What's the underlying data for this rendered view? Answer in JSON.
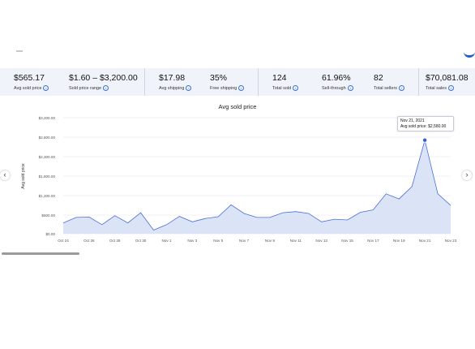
{
  "stats": [
    {
      "value": "$565.17",
      "label": "Avg sold price"
    },
    {
      "value": "$1.60 – $3,200.00",
      "label": "Sold price range"
    },
    {
      "value": "$17.98",
      "label": "Avg shipping"
    },
    {
      "value": "35%",
      "label": "Free shipping"
    },
    {
      "value": "124",
      "label": "Total sold"
    },
    {
      "value": "61.96%",
      "label": "Sell-through"
    },
    {
      "value": "82",
      "label": "Total sellers"
    },
    {
      "value": "$70,081.08",
      "label": "Total sales"
    }
  ],
  "chart_data": {
    "type": "area",
    "title": "Avg sold price",
    "ylabel": "Avg sold price",
    "xlabel": "",
    "ylim": [
      0,
      3200
    ],
    "yticks": [
      "$3,200.00",
      "$2,800.00",
      "$2,300.00",
      "$1,800.00",
      "$1,500.00",
      "$1,200.00",
      "$600.00",
      "$0.00"
    ],
    "xticks": [
      "Oct 24",
      "Oct 26",
      "Oct 28",
      "Oct 30",
      "Nov 1",
      "Nov 3",
      "Nov 5",
      "Nov 7",
      "Nov 9",
      "Nov 11",
      "Nov 13",
      "Nov 15",
      "Nov 17",
      "Nov 19",
      "Nov 21",
      "Nov 23"
    ],
    "x": [
      "Oct 24",
      "Oct 25",
      "Oct 26",
      "Oct 27",
      "Oct 28",
      "Oct 29",
      "Oct 30",
      "Oct 31",
      "Nov 1",
      "Nov 2",
      "Nov 3",
      "Nov 4",
      "Nov 5",
      "Nov 6",
      "Nov 7",
      "Nov 8",
      "Nov 9",
      "Nov 10",
      "Nov 11",
      "Nov 12",
      "Nov 13",
      "Nov 14",
      "Nov 15",
      "Nov 16",
      "Nov 17",
      "Nov 18",
      "Nov 19",
      "Nov 20",
      "Nov 21",
      "Nov 22",
      "Nov 23"
    ],
    "series": [
      {
        "values": [
          300,
          450,
          460,
          250,
          500,
          300,
          580,
          100,
          250,
          480,
          330,
          420,
          470,
          800,
          560,
          450,
          450,
          580,
          610,
          560,
          330,
          400,
          380,
          590,
          660,
          1100,
          960,
          1300,
          2580,
          1100,
          780
        ]
      }
    ],
    "highlight": {
      "date": "Nov 21, 2021",
      "label": "Avg sold price: $2,580.00"
    },
    "grid": true,
    "colors": {
      "line": "#4a6fd6",
      "fill": "#dbe3f7",
      "marker": "#2f5fd1"
    }
  },
  "icons": {
    "info": "info-icon",
    "prev": "chevron-left-icon",
    "next": "chevron-right-icon"
  }
}
